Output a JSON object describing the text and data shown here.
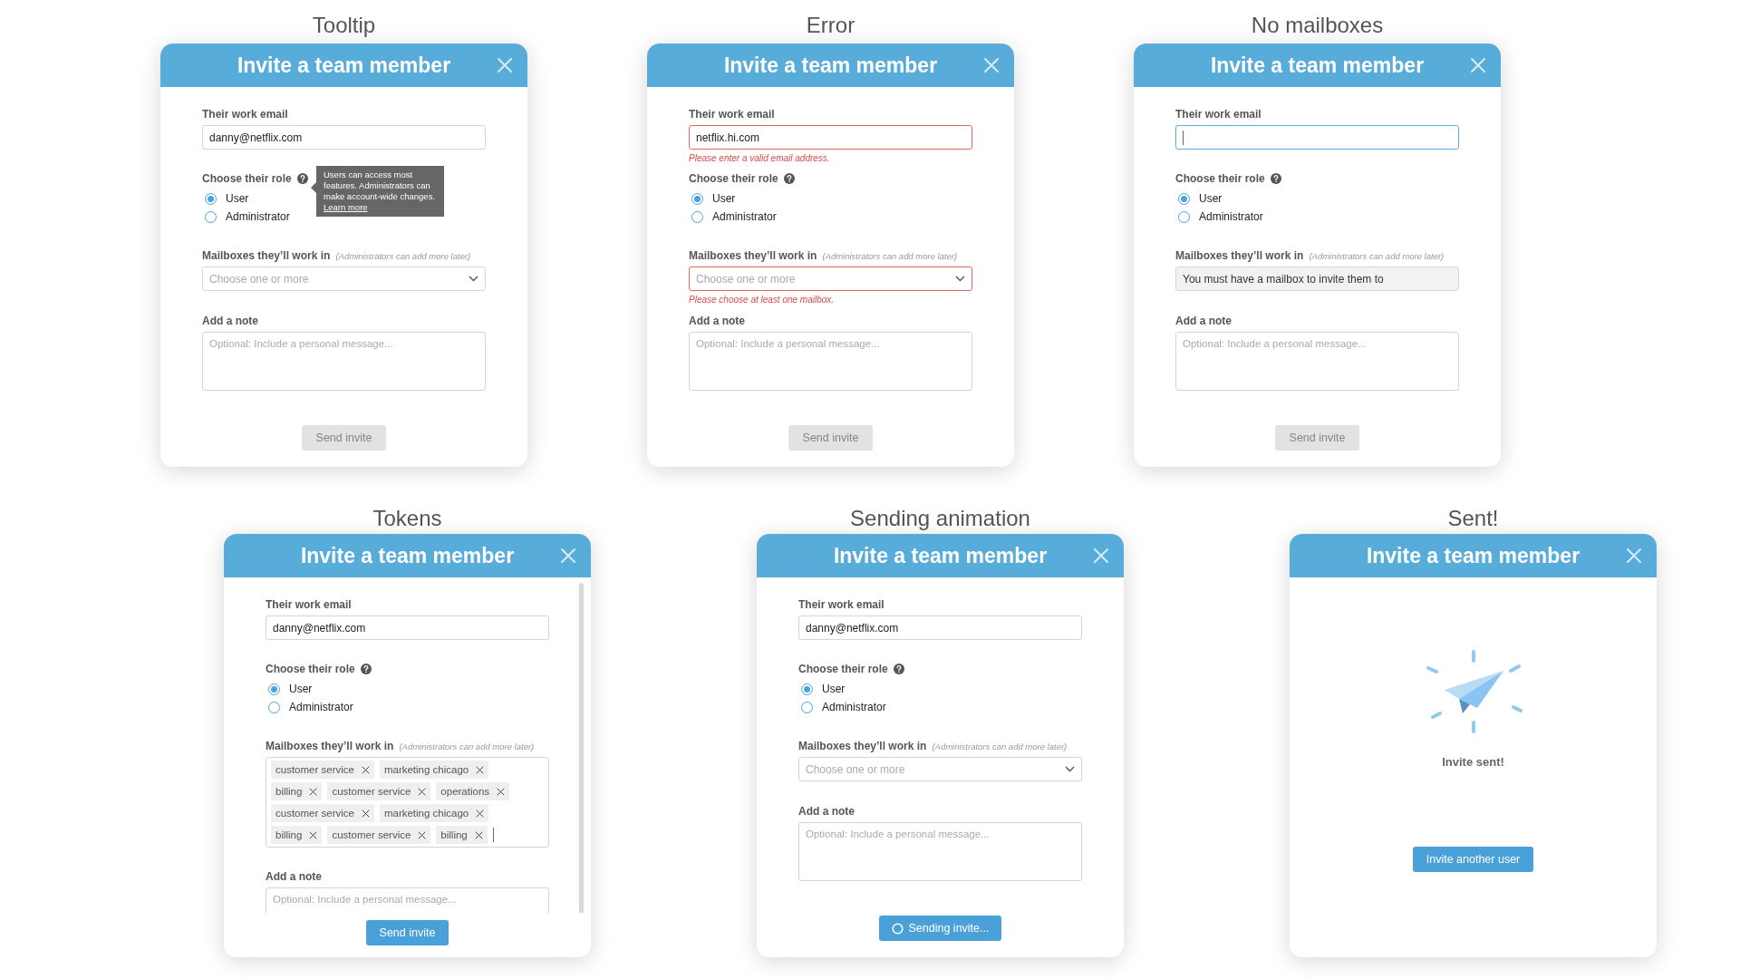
{
  "rows": [
    {
      "panels": [
        {
          "caption": "Tooltip",
          "kind": "form",
          "title": "Invite a team member",
          "email": {
            "label": "Their work email",
            "value": "danny@netflix.com",
            "focused": false
          },
          "role": {
            "label": "Choose their role",
            "tooltip": {
              "text": "Users can access most features. Administrators can make account-wide changes.",
              "link": "Learn more"
            },
            "options": [
              {
                "label": "User",
                "selected": true
              },
              {
                "label": "Administrator",
                "selected": false
              }
            ]
          },
          "mailboxes": {
            "label": "Mailboxes they’ll work in",
            "hint": "(Administrators can add more later)",
            "kind": "select",
            "placeholder": "Choose one or more"
          },
          "note": {
            "label": "Add a note",
            "placeholder": "Optional: Include a personal message..."
          },
          "button": {
            "label": "Send invite",
            "kind": "disabled"
          }
        },
        {
          "caption": "Error",
          "kind": "form",
          "title": "Invite a team member",
          "email": {
            "label": "Their work email",
            "value": "netflix.hi.com",
            "focused": false,
            "error": "Please enter a valid email address."
          },
          "role": {
            "label": "Choose their role",
            "options": [
              {
                "label": "User",
                "selected": true
              },
              {
                "label": "Administrator",
                "selected": false
              }
            ]
          },
          "mailboxes": {
            "label": "Mailboxes they’ll work in",
            "hint": "(Administrators can add more later)",
            "kind": "select",
            "placeholder": "Choose one or more",
            "error": "Please choose at least one mailbox."
          },
          "note": {
            "label": "Add a note",
            "placeholder": "Optional: Include a personal message..."
          },
          "button": {
            "label": "Send invite",
            "kind": "disabled"
          }
        },
        {
          "caption": "No mailboxes",
          "kind": "form",
          "title": "Invite a team member",
          "email": {
            "label": "Their work email",
            "focused": true
          },
          "role": {
            "label": "Choose their role",
            "options": [
              {
                "label": "User",
                "selected": true
              },
              {
                "label": "Administrator",
                "selected": false
              }
            ]
          },
          "mailboxes": {
            "label": "Mailboxes they’ll work in",
            "hint": "(Administrators can add more later)",
            "kind": "notice",
            "value": "You must have a mailbox to invite them to"
          },
          "note": {
            "label": "Add a note",
            "placeholder": "Optional: Include a personal message..."
          },
          "button": {
            "label": "Send invite",
            "kind": "disabled"
          }
        }
      ]
    },
    {
      "panels": [
        {
          "caption": "Tokens",
          "kind": "form",
          "scrollable": true,
          "title": "Invite a team member",
          "email": {
            "label": "Their work email",
            "value": "danny@netflix.com",
            "focused": false
          },
          "role": {
            "label": "Choose their role",
            "options": [
              {
                "label": "User",
                "selected": true
              },
              {
                "label": "Administrator",
                "selected": false
              }
            ]
          },
          "mailboxes": {
            "label": "Mailboxes they’ll work in",
            "hint": "(Administrators can add more later)",
            "kind": "tokens",
            "focused": true,
            "tokens": [
              "customer service",
              "marketing chicago",
              "billing",
              "customer service",
              "operations",
              "customer service",
              "marketing chicago",
              "billing",
              "customer service",
              "billing"
            ]
          },
          "note": {
            "label": "Add a note",
            "placeholder": "Optional: Include a personal message..."
          },
          "button": {
            "label": "Send invite",
            "kind": "primary"
          }
        },
        {
          "caption": "Sending animation",
          "kind": "form",
          "title": "Invite a team member",
          "email": {
            "label": "Their work email",
            "value": "danny@netflix.com",
            "focused": false
          },
          "role": {
            "label": "Choose their role",
            "options": [
              {
                "label": "User",
                "selected": true
              },
              {
                "label": "Administrator",
                "selected": false
              }
            ]
          },
          "mailboxes": {
            "label": "Mailboxes they’ll work in",
            "hint": "(Administrators can add more later)",
            "kind": "select",
            "placeholder": "Choose one or more"
          },
          "note": {
            "label": "Add a note",
            "placeholder": "Optional: Include a personal message..."
          },
          "button": {
            "label": "Sending invite...",
            "kind": "sending"
          }
        },
        {
          "caption": "Sent!",
          "kind": "sent",
          "title": "Invite a team member",
          "message": "Invite sent!",
          "button": {
            "label": "Invite another user",
            "kind": "primary"
          }
        }
      ]
    }
  ]
}
